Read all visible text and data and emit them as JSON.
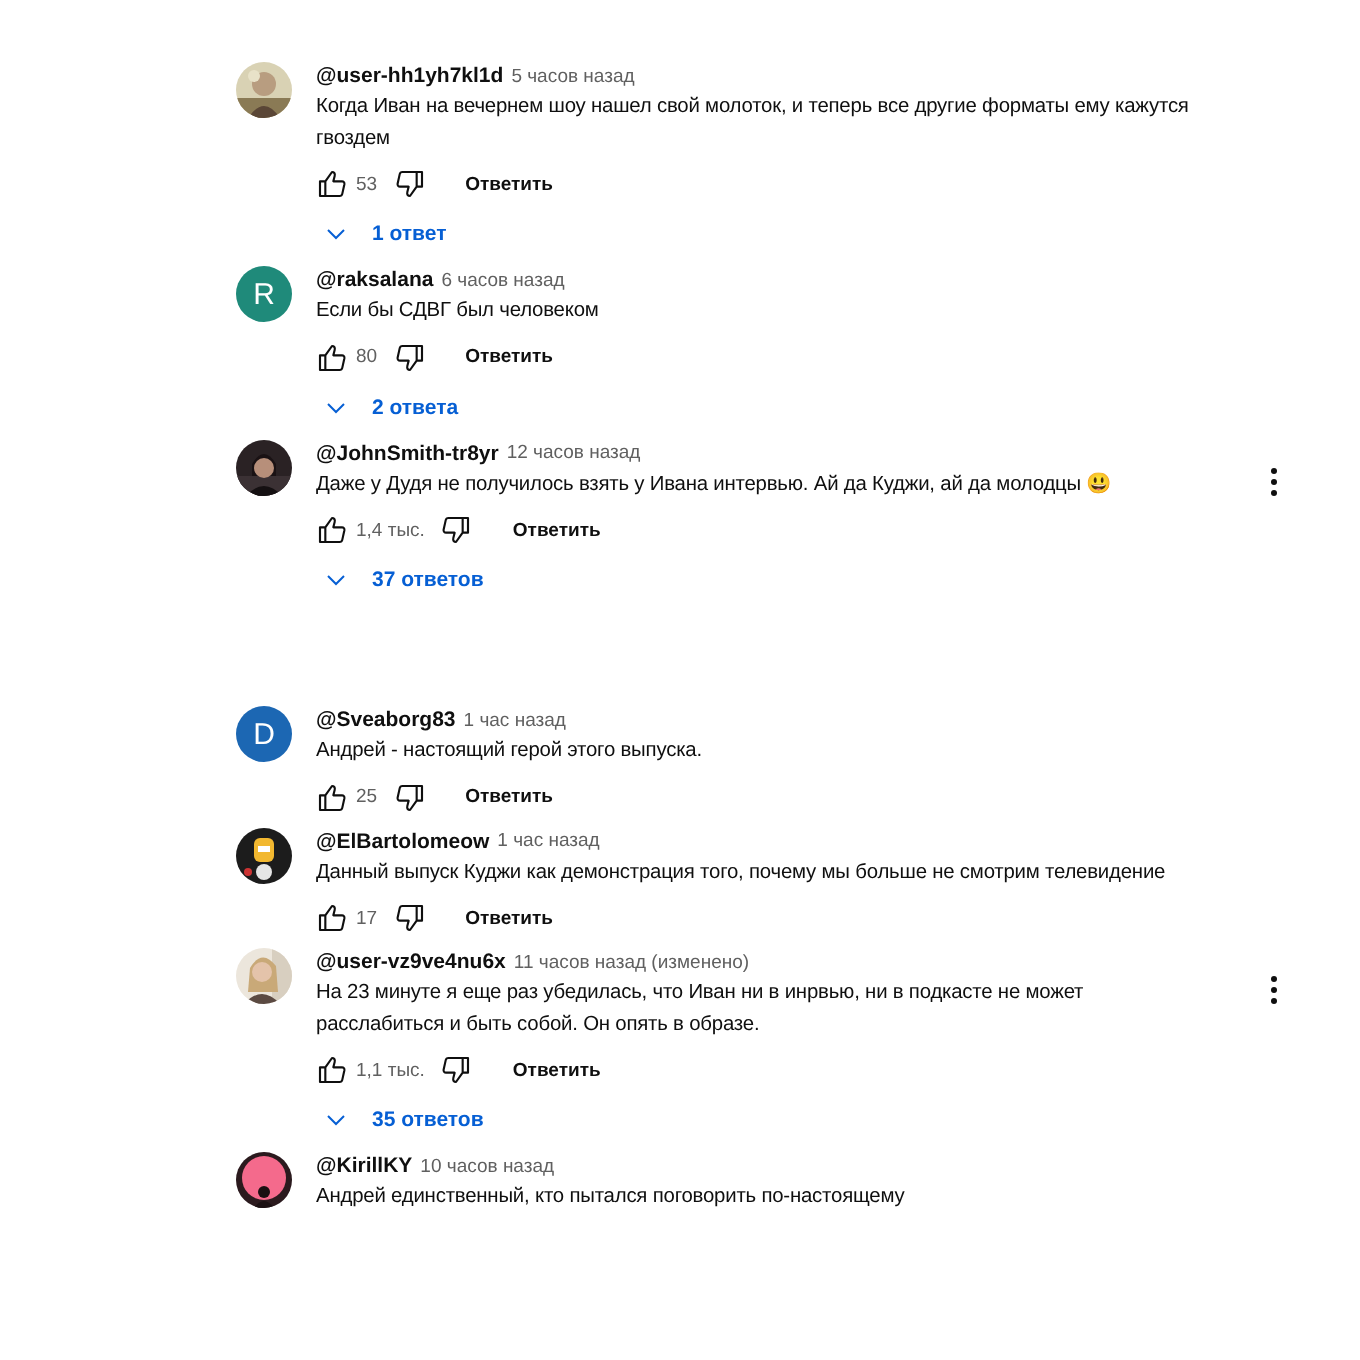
{
  "comments": [
    {
      "author": "@user-hh1yh7kl1d",
      "time": "5 часов назад",
      "text": "Когда Иван на вечернем шоу нашел свой молоток, и теперь все другие форматы ему кажутся гвоздем",
      "likes": "53",
      "reply_button": "Ответить",
      "replies": "1 ответ",
      "menu": false
    },
    {
      "author": "@raksalana",
      "time": "6 часов назад",
      "text": "Если бы СДВГ был человеком",
      "avatar": {
        "kind": "letter",
        "letter": "R",
        "color": "#1f8a7a"
      },
      "likes": "80",
      "reply_button": "Ответить",
      "replies": "2 ответа",
      "menu": false
    },
    {
      "author": "@JohnSmith-tr8yr",
      "time": "12 часов назад",
      "text": "Даже у Дудя не получилось взять у Ивана интервью. Ай да Куджи, ай да молодцы 😃",
      "likes": "1,4 тыс.",
      "reply_button": "Ответить",
      "replies": "37 ответов",
      "menu": true
    },
    {
      "author": "@Sveaborg83",
      "time": "1 час назад",
      "text": "Андрей - настоящий герой этого выпуска.",
      "avatar": {
        "kind": "letter",
        "letter": "D",
        "color": "#1c67b3"
      },
      "likes": "25",
      "reply_button": "Ответить",
      "menu": false
    },
    {
      "author": "@ElBartolomeow",
      "time": "1 час назад",
      "text": "Данный выпуск Куджи как демонстрация того, почему мы больше не смотрим телевидение",
      "likes": "17",
      "reply_button": "Ответить",
      "menu": false
    },
    {
      "author": "@user-vz9ve4nu6x",
      "time": "11 часов назад (изменено)",
      "text": "На 23 минуте я еще раз убедилась, что Иван ни в инрвью, ни в подкасте не может расслабиться и быть собой. Он опять в образе.",
      "likes": "1,1 тыс.",
      "reply_button": "Ответить",
      "replies": "35 ответов",
      "menu": true
    },
    {
      "author": "@KirillKY",
      "time": "10 часов назад",
      "text": "Андрей единственный, кто пытался поговорить по-настоящему",
      "menu": false
    }
  ]
}
